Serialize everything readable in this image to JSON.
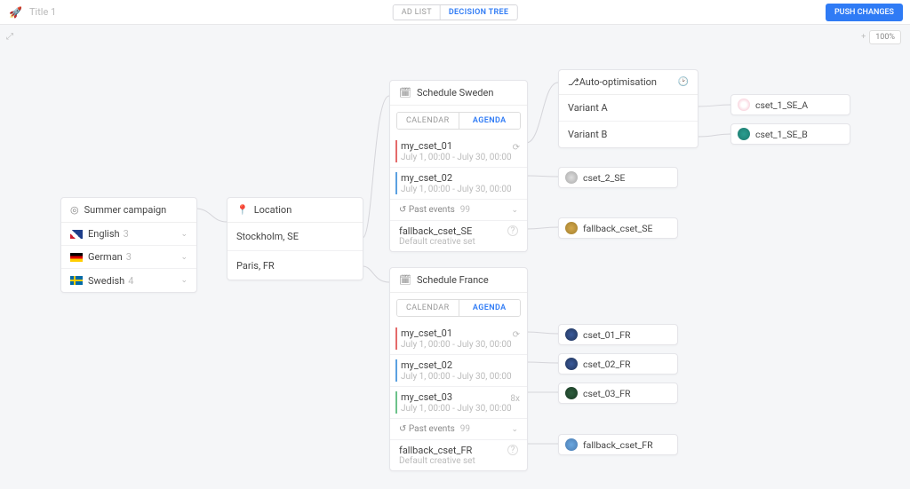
{
  "header": {
    "title": "Title 1",
    "views": {
      "list": "AD LIST",
      "tree": "DECISION TREE"
    },
    "push": "PUSH CHANGES"
  },
  "zoom": {
    "value": "100%"
  },
  "campaign": {
    "title": "Summer campaign",
    "langs": [
      {
        "label": "English",
        "count": "3",
        "flag": "en"
      },
      {
        "label": "German",
        "count": "3",
        "flag": "de"
      },
      {
        "label": "Swedish",
        "count": "4",
        "flag": "sv"
      }
    ]
  },
  "location": {
    "title": "Location",
    "rows": [
      {
        "label": "Stockholm, SE"
      },
      {
        "label": "Paris, FR"
      }
    ]
  },
  "schedule_se": {
    "title": "Schedule Sweden",
    "tabs": {
      "cal": "CALENDAR",
      "agenda": "AGENDA"
    },
    "items": [
      {
        "name": "my_cset_01",
        "sub": "July 1, 00:00 - July 30, 00:00",
        "recycle": "⟳",
        "bar": "red"
      },
      {
        "name": "my_cset_02",
        "sub": "July 1, 00:00 - July 30, 00:00",
        "bar": "blue"
      }
    ],
    "past": {
      "label": "Past events",
      "count": "99"
    },
    "fallback": {
      "name": "fallback_cset_SE",
      "sub": "Default creative set"
    }
  },
  "schedule_fr": {
    "title": "Schedule France",
    "tabs": {
      "cal": "CALENDAR",
      "agenda": "AGENDA"
    },
    "items": [
      {
        "name": "my_cset_01",
        "sub": "July 1, 00:00 - July 30, 00:00",
        "recycle": "⟳",
        "bar": "red"
      },
      {
        "name": "my_cset_02",
        "sub": "July 1, 00:00 - July 30, 00:00",
        "bar": "blue"
      },
      {
        "name": "my_cset_03",
        "sub": "July 1, 00:00 - July 30, 00:00",
        "tag": "8x",
        "bar": "green"
      }
    ],
    "past": {
      "label": "Past events",
      "count": "99"
    },
    "fallback": {
      "name": "fallback_cset_FR",
      "sub": "Default creative set"
    }
  },
  "optim": {
    "title": "Auto-optimisation",
    "rows": [
      {
        "label": "Variant A"
      },
      {
        "label": "Variant B"
      }
    ]
  },
  "csets": {
    "se_a": "cset_1_SE_A",
    "se_b": "cset_1_SE_B",
    "se_2": "cset_2_SE",
    "se_fb": "fallback_cset_SE",
    "fr_1": "cset_01_FR",
    "fr_2": "cset_02_FR",
    "fr_3": "cset_03_FR",
    "fr_fb": "fallback_cset_FR"
  }
}
